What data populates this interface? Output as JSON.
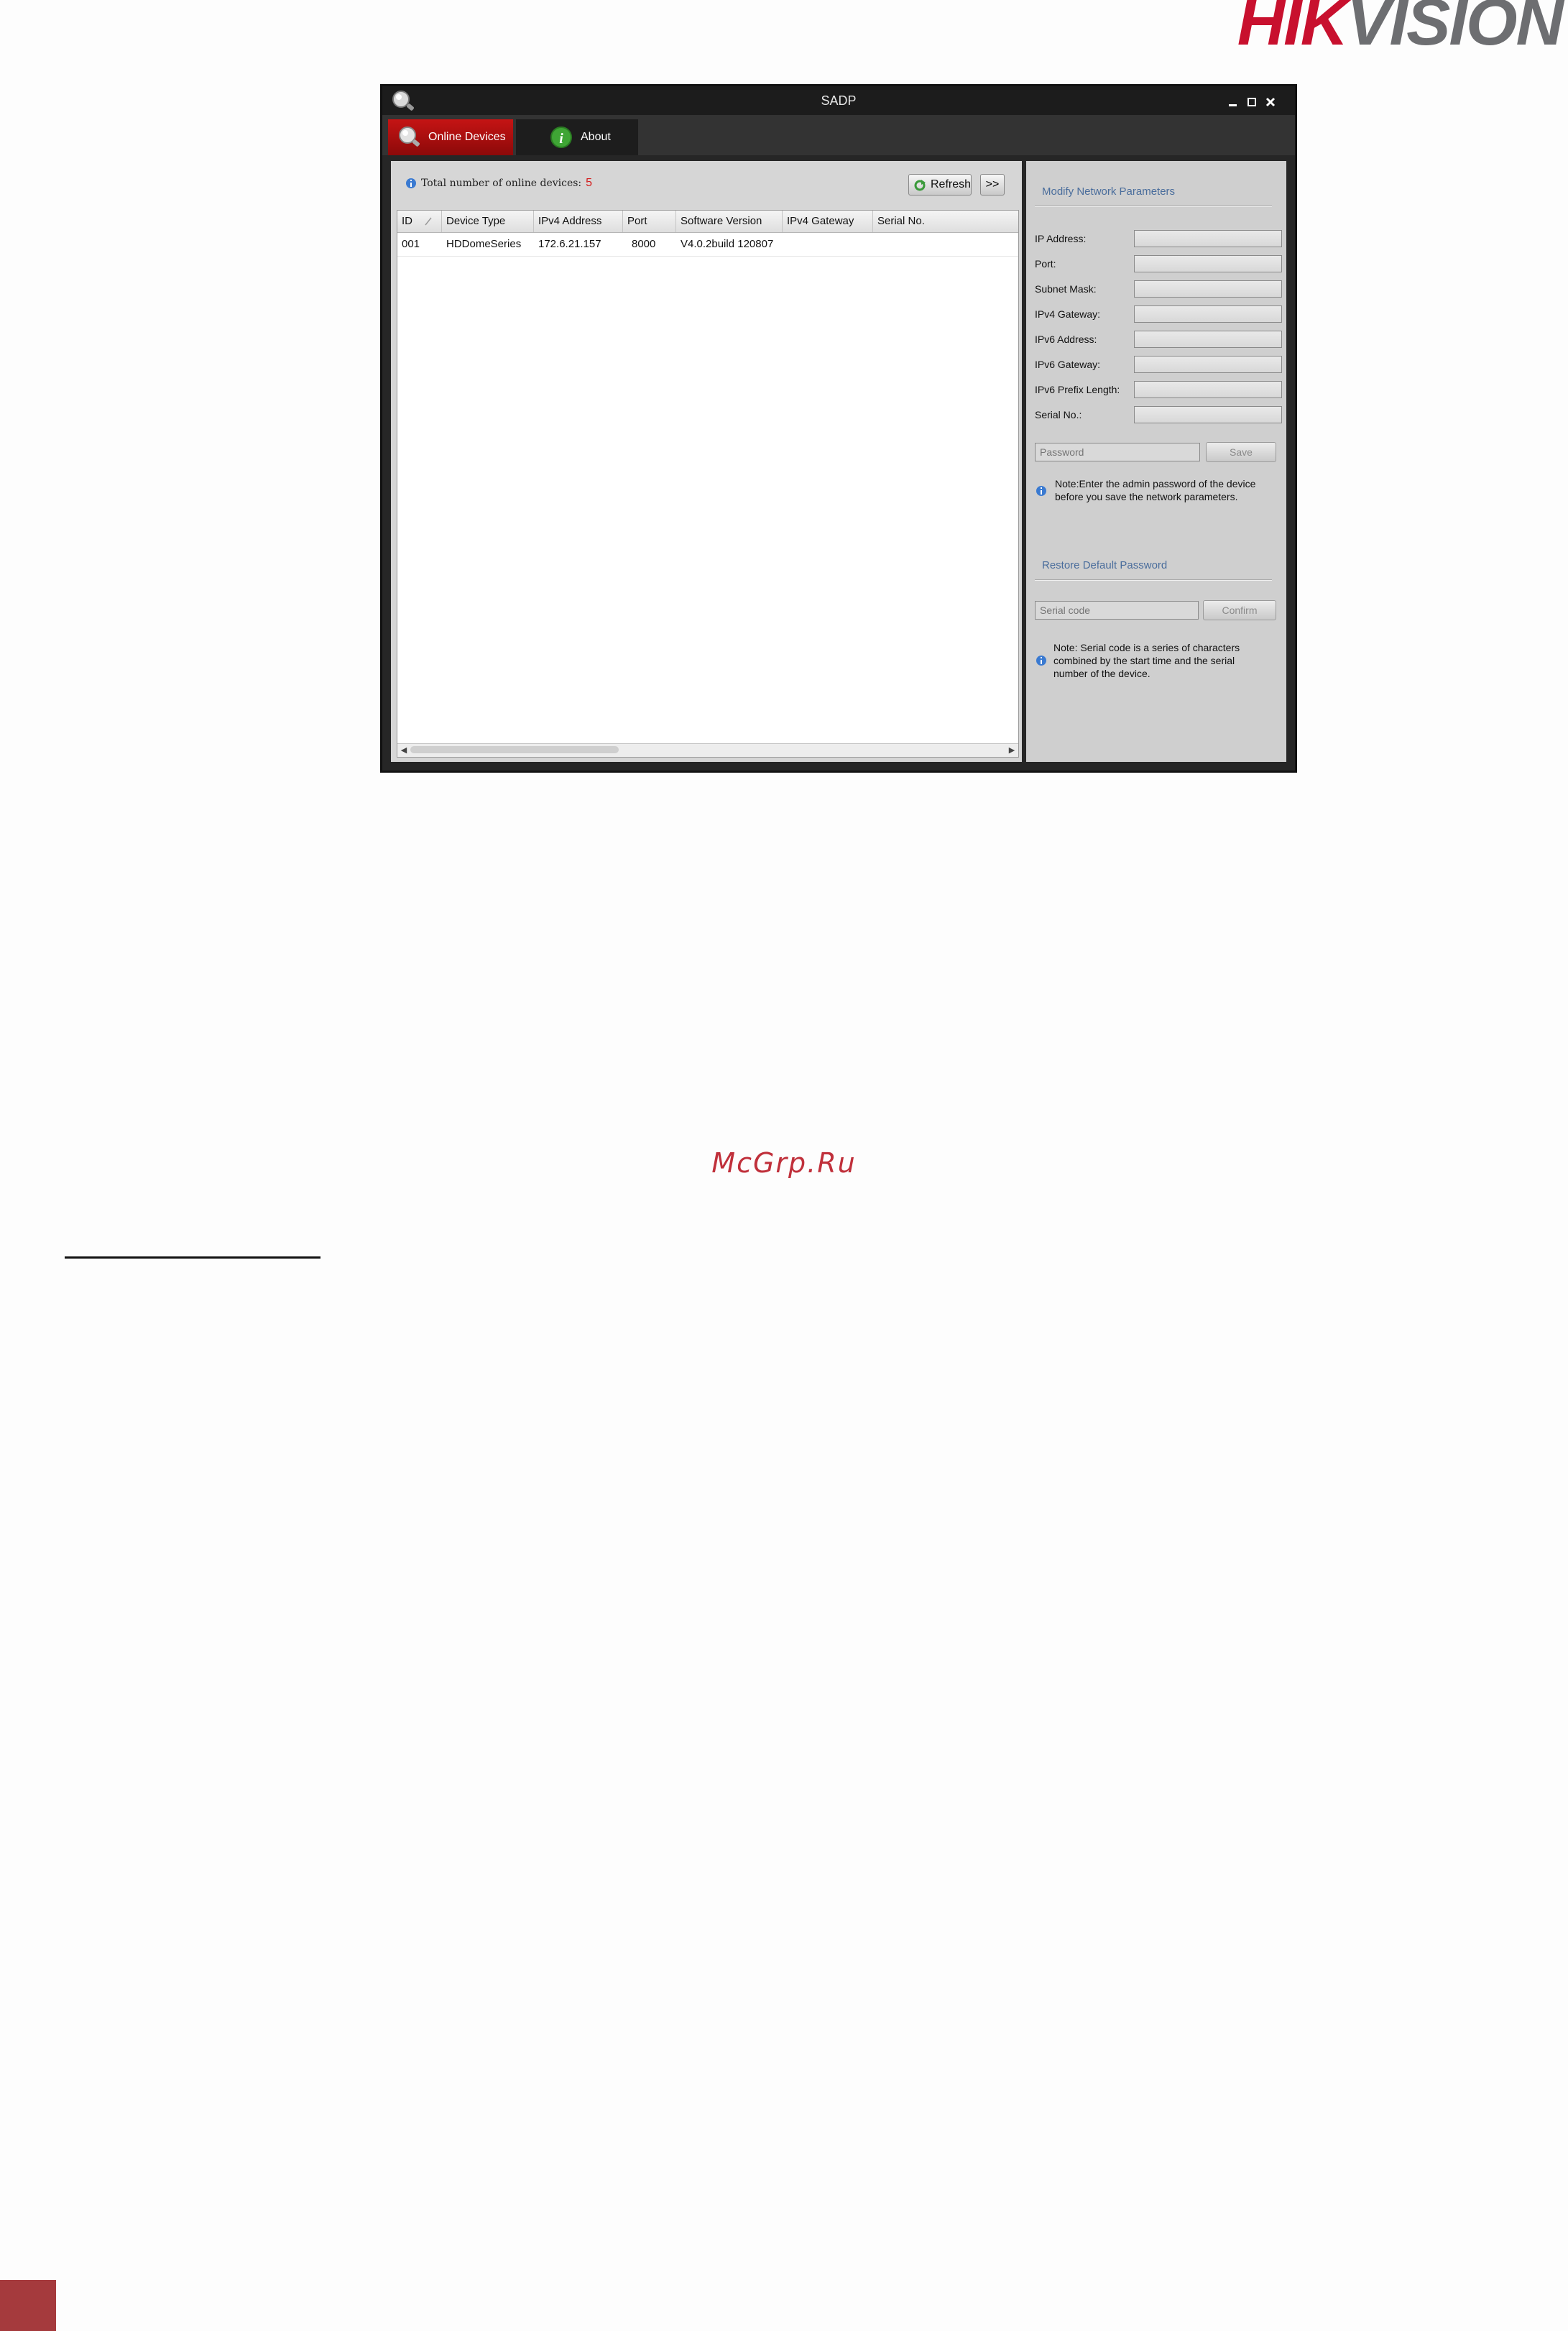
{
  "logo": {
    "part1": "HIK",
    "part2": "VISION"
  },
  "window": {
    "title": "SADP",
    "tabs": [
      {
        "label": "Online Devices",
        "active": true
      },
      {
        "label": "About",
        "active": false
      }
    ],
    "summary": {
      "label": "Total number of online devices:",
      "count": "5"
    },
    "toolbar": {
      "refresh_label": "Refresh",
      "more_label": ">>"
    },
    "table": {
      "columns": [
        "ID",
        "Device Type",
        "IPv4 Address",
        "Port",
        "Software Version",
        "IPv4 Gateway",
        "Serial No."
      ],
      "rows": [
        [
          "001",
          "HDDomeSeries",
          "172.6.21.157",
          "8000",
          "V4.0.2build 120807",
          "",
          ""
        ]
      ]
    },
    "modify": {
      "title": "Modify Network Parameters",
      "fields": [
        {
          "label": "IP Address:"
        },
        {
          "label": "Port:"
        },
        {
          "label": "Subnet Mask:"
        },
        {
          "label": "IPv4 Gateway:"
        },
        {
          "label": "IPv6 Address:"
        },
        {
          "label": "IPv6 Gateway:"
        },
        {
          "label": "IPv6 Prefix Length:"
        },
        {
          "label": "Serial No.:"
        }
      ],
      "password_placeholder": "Password",
      "save_label": "Save",
      "note_line1": "Note:Enter the admin password of the device",
      "note_line2": "before you save the network parameters."
    },
    "restore": {
      "title": "Restore Default Password",
      "serial_placeholder": "Serial code",
      "confirm_label": "Confirm",
      "note_line1": "Note: Serial code is a series of characters",
      "note_line2": "combined by the start time and the serial",
      "note_line3": "number of the device."
    }
  },
  "watermark": "McGrp.Ru",
  "colors": {
    "brand_red": "#c8102e",
    "accent_blue": "#4a6d9c",
    "tab_active": "#c51414"
  }
}
